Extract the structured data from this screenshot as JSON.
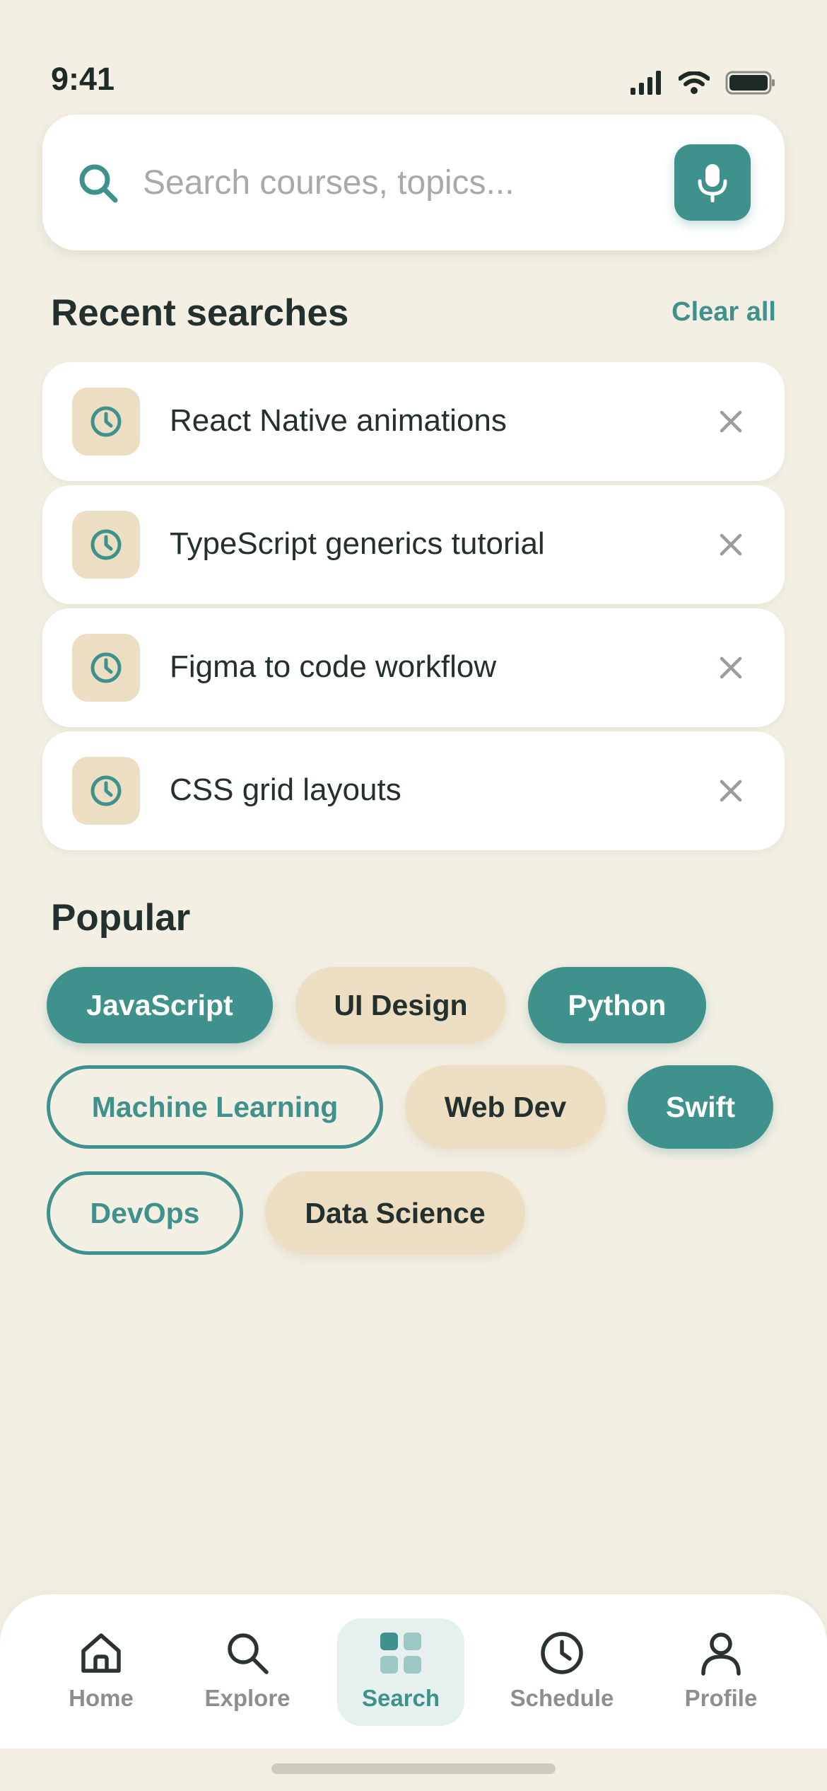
{
  "status_bar": {
    "time": "9:41"
  },
  "search": {
    "placeholder": "Search courses, topics...",
    "value": ""
  },
  "recent": {
    "title": "Recent searches",
    "clear_label": "Clear all",
    "items": [
      {
        "label": "React Native animations"
      },
      {
        "label": "TypeScript generics tutorial"
      },
      {
        "label": "Figma to code workflow"
      },
      {
        "label": "CSS grid layouts"
      }
    ]
  },
  "popular": {
    "title": "Popular",
    "chips": [
      {
        "label": "JavaScript",
        "style": "filled"
      },
      {
        "label": "UI Design",
        "style": "beige"
      },
      {
        "label": "Python",
        "style": "filled"
      },
      {
        "label": "Machine Learning",
        "style": "outline"
      },
      {
        "label": "Web Dev",
        "style": "beige"
      },
      {
        "label": "Swift",
        "style": "filled"
      },
      {
        "label": "DevOps",
        "style": "outline"
      },
      {
        "label": "Data Science",
        "style": "beige"
      }
    ]
  },
  "nav": {
    "items": [
      {
        "label": "Home",
        "icon": "home-icon"
      },
      {
        "label": "Explore",
        "icon": "search-icon"
      },
      {
        "label": "Search",
        "icon": "grid-icon",
        "active": true
      },
      {
        "label": "Schedule",
        "icon": "clock-icon"
      },
      {
        "label": "Profile",
        "icon": "user-icon"
      }
    ]
  },
  "colors": {
    "accent": "#3f918b",
    "background": "#f3efe4",
    "chip_beige": "#ecdec2",
    "text": "#24302d"
  }
}
